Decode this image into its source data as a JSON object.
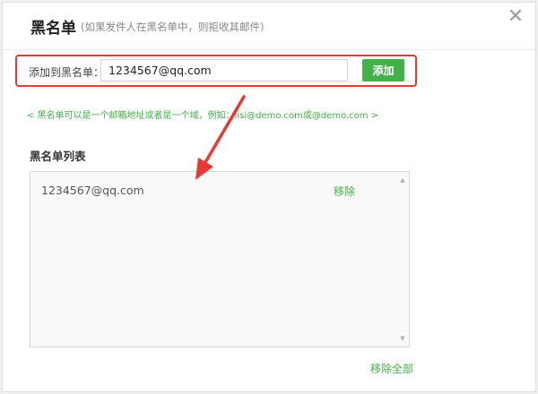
{
  "dialog": {
    "title": "黑名单",
    "subtitle": "(如果发件人在黑名单中，则拒收其邮件)",
    "close_icon": "✕"
  },
  "add": {
    "label": "添加到黑名单：",
    "value": "1234567@qq.com",
    "button_label": "添加"
  },
  "hint": "< 黑名单可以是一个邮箱地址或者是一个域，例如：lisi@demo.com或@demo.com >",
  "list": {
    "title": "黑名单列表",
    "items": [
      {
        "email": "1234567@qq.com",
        "remove_label": "移除"
      }
    ],
    "scroll_up_icon": "▲",
    "scroll_down_icon": "▼"
  },
  "remove_all_label": "移除全部",
  "colors": {
    "accent_green": "#43b049",
    "highlight_red": "#e53935"
  }
}
